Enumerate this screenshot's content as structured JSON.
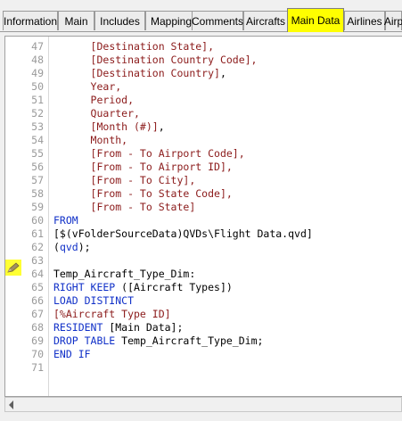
{
  "tabs": [
    {
      "label": "Information",
      "active": false
    },
    {
      "label": "Main",
      "active": false
    },
    {
      "label": "Includes",
      "active": false
    },
    {
      "label": "Mapping",
      "active": false
    },
    {
      "label": "Comments",
      "active": false
    },
    {
      "label": "Aircrafts",
      "active": false
    },
    {
      "label": "Main Data",
      "active": true
    },
    {
      "label": "Airlines",
      "active": false
    },
    {
      "label": "Airp",
      "active": false
    }
  ],
  "colors": {
    "keyword": "#1030c8",
    "field": "#8b1a1a",
    "line_number": "#9a9a9a",
    "highlight": "#ffff00"
  },
  "editor": {
    "marker_icon": "pencil-icon",
    "marker_line": 64,
    "lines": [
      {
        "num": "47",
        "segments": [
          {
            "t": "      "
          },
          {
            "t": "[Destination State],",
            "c": "fld"
          }
        ]
      },
      {
        "num": "48",
        "segments": [
          {
            "t": "      "
          },
          {
            "t": "[Destination Country Code],",
            "c": "fld"
          }
        ]
      },
      {
        "num": "49",
        "segments": [
          {
            "t": "      "
          },
          {
            "t": "[Destination Country]",
            "c": "fld"
          },
          {
            "t": ","
          }
        ]
      },
      {
        "num": "50",
        "segments": [
          {
            "t": "      "
          },
          {
            "t": "Year,",
            "c": "fld"
          }
        ]
      },
      {
        "num": "51",
        "segments": [
          {
            "t": "      "
          },
          {
            "t": "Period,",
            "c": "fld"
          }
        ]
      },
      {
        "num": "52",
        "segments": [
          {
            "t": "      "
          },
          {
            "t": "Quarter,",
            "c": "fld"
          }
        ]
      },
      {
        "num": "53",
        "segments": [
          {
            "t": "      "
          },
          {
            "t": "[Month (#)]",
            "c": "fld"
          },
          {
            "t": ","
          }
        ]
      },
      {
        "num": "54",
        "segments": [
          {
            "t": "      "
          },
          {
            "t": "Month,",
            "c": "fld"
          }
        ]
      },
      {
        "num": "55",
        "segments": [
          {
            "t": "      "
          },
          {
            "t": "[From - To Airport Code],",
            "c": "fld"
          }
        ]
      },
      {
        "num": "56",
        "segments": [
          {
            "t": "      "
          },
          {
            "t": "[From - To Airport ID],",
            "c": "fld"
          }
        ]
      },
      {
        "num": "57",
        "segments": [
          {
            "t": "      "
          },
          {
            "t": "[From - To City],",
            "c": "fld"
          }
        ]
      },
      {
        "num": "58",
        "segments": [
          {
            "t": "      "
          },
          {
            "t": "[From - To State Code],",
            "c": "fld"
          }
        ]
      },
      {
        "num": "59",
        "segments": [
          {
            "t": "      "
          },
          {
            "t": "[From - To State]",
            "c": "fld"
          }
        ]
      },
      {
        "num": "60",
        "segments": [
          {
            "t": "FROM",
            "c": "kw"
          }
        ]
      },
      {
        "num": "61",
        "segments": [
          {
            "t": "[$(vFolderSourceData)QVDs\\Flight Data.qvd]"
          }
        ]
      },
      {
        "num": "62",
        "segments": [
          {
            "t": "("
          },
          {
            "t": "qvd",
            "c": "kw"
          },
          {
            "t": ");"
          }
        ]
      },
      {
        "num": "63",
        "segments": []
      },
      {
        "num": "64",
        "segments": [
          {
            "t": "Temp_Aircraft_Type_Dim:"
          }
        ]
      },
      {
        "num": "65",
        "segments": [
          {
            "t": "RIGHT KEEP",
            "c": "kw"
          },
          {
            "t": " ([Aircraft Types])"
          }
        ]
      },
      {
        "num": "66",
        "segments": [
          {
            "t": "LOAD DISTINCT",
            "c": "kw"
          }
        ]
      },
      {
        "num": "67",
        "segments": [
          {
            "t": "[%Aircraft Type ID]",
            "c": "fld"
          }
        ]
      },
      {
        "num": "68",
        "segments": [
          {
            "t": "RESIDENT",
            "c": "kw"
          },
          {
            "t": " [Main Data];"
          }
        ]
      },
      {
        "num": "69",
        "segments": [
          {
            "t": "DROP TABLE",
            "c": "kw"
          },
          {
            "t": " Temp_Aircraft_Type_Dim;"
          }
        ]
      },
      {
        "num": "70",
        "segments": [
          {
            "t": "END IF",
            "c": "kw"
          }
        ]
      },
      {
        "num": "71",
        "segments": []
      }
    ]
  }
}
